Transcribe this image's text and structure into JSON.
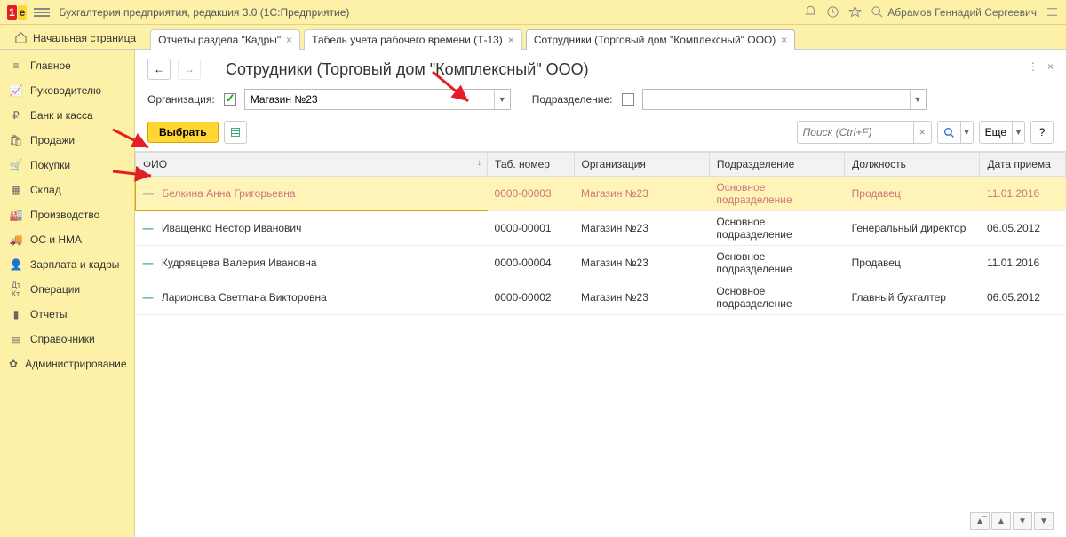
{
  "header": {
    "logo_text": "1С",
    "app_title": "Бухгалтерия предприятия, редакция 3.0  (1С:Предприятие)",
    "user": "Абрамов Геннадий Сергеевич"
  },
  "tabs": {
    "start": "Начальная страница",
    "items": [
      {
        "label": "Отчеты раздела \"Кадры\""
      },
      {
        "label": "Табель учета рабочего времени (Т-13)"
      },
      {
        "label": "Сотрудники (Торговый дом \"Комплексный\" ООО)",
        "active": true
      }
    ]
  },
  "sidebar": {
    "items": [
      {
        "label": "Главное",
        "icon": "≡"
      },
      {
        "label": "Руководителю",
        "icon": "↗"
      },
      {
        "label": "Банк и касса",
        "icon": "₽"
      },
      {
        "label": "Продажи",
        "icon": "🛍"
      },
      {
        "label": "Покупки",
        "icon": "🛒"
      },
      {
        "label": "Склад",
        "icon": "▦"
      },
      {
        "label": "Производство",
        "icon": "🏭"
      },
      {
        "label": "ОС и НМА",
        "icon": "🚚"
      },
      {
        "label": "Зарплата и кадры",
        "icon": "👤"
      },
      {
        "label": "Операции",
        "icon": "Дт"
      },
      {
        "label": "Отчеты",
        "icon": "▮"
      },
      {
        "label": "Справочники",
        "icon": "▤"
      },
      {
        "label": "Администрирование",
        "icon": "✿"
      }
    ]
  },
  "page": {
    "title": "Сотрудники (Торговый дом \"Комплексный\" ООО)",
    "org_label": "Организация:",
    "org_value": "Магазин №23",
    "dept_label": "Подразделение:",
    "dept_value": "",
    "select_btn": "Выбрать",
    "search_placeholder": "Поиск (Ctrl+F)",
    "more_btn": "Еще"
  },
  "table": {
    "columns": [
      "ФИО",
      "Таб. номер",
      "Организация",
      "Подразделение",
      "Должность",
      "Дата приема"
    ],
    "rows": [
      {
        "fio": "Белкина Анна Григорьевна",
        "tab": "0000-00003",
        "org": "Магазин №23",
        "dept": "Основное подразделение",
        "pos": "Продавец",
        "date": "11.01.2016",
        "selected": true
      },
      {
        "fio": "Иващенко Нестор Иванович",
        "tab": "0000-00001",
        "org": "Магазин №23",
        "dept": "Основное подразделение",
        "pos": "Генеральный директор",
        "date": "06.05.2012"
      },
      {
        "fio": "Кудрявцева Валерия Ивановна",
        "tab": "0000-00004",
        "org": "Магазин №23",
        "dept": "Основное подразделение",
        "pos": "Продавец",
        "date": "11.01.2016"
      },
      {
        "fio": "Ларионова Светлана Викторовна",
        "tab": "0000-00002",
        "org": "Магазин №23",
        "dept": "Основное подразделение",
        "pos": "Главный бухгалтер",
        "date": "06.05.2012"
      }
    ]
  }
}
